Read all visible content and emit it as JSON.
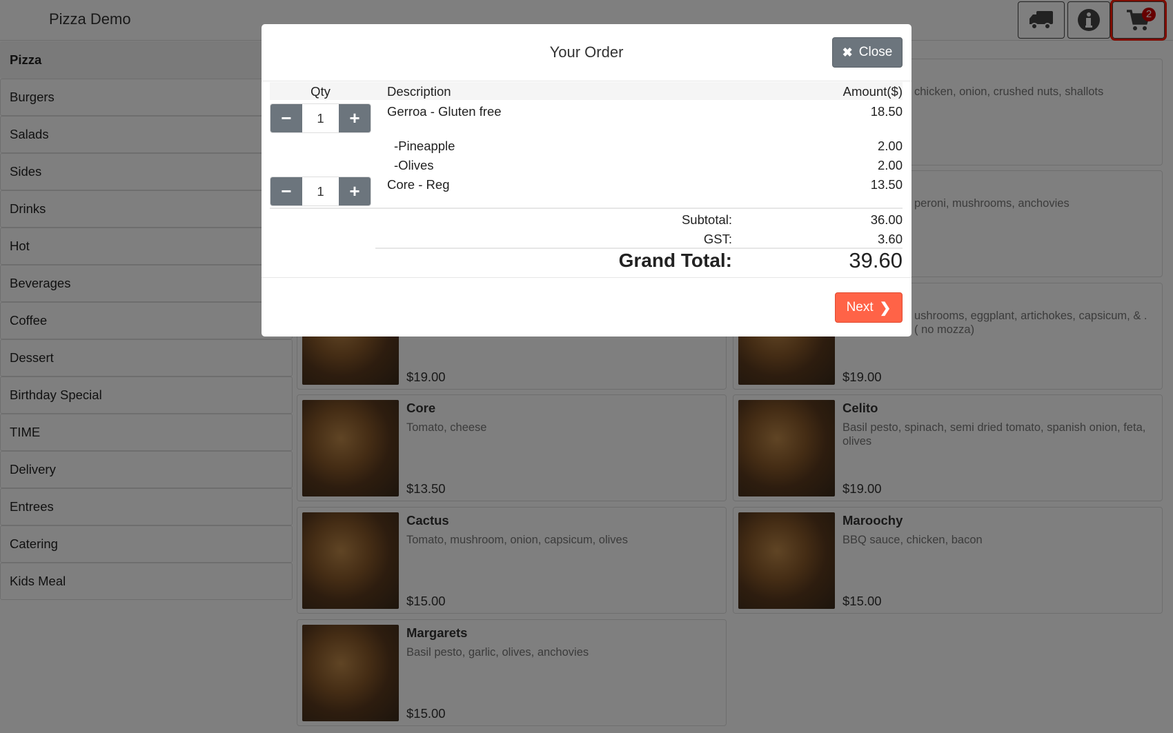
{
  "app": {
    "title": "Pizza Demo"
  },
  "header": {
    "buttons": [
      {
        "icon": "truck-icon"
      },
      {
        "icon": "info-icon"
      },
      {
        "icon": "cart-icon",
        "badge": "2"
      }
    ]
  },
  "sidebar": {
    "items": [
      "Pizza",
      "Burgers",
      "Salads",
      "Sides",
      "Drinks",
      "Hot",
      "Beverages",
      "Coffee",
      "Dessert",
      "Birthday Special",
      "TIME",
      "Delivery",
      "Entrees",
      "Catering",
      "Kids Meal"
    ]
  },
  "products": [
    {
      "name": "",
      "desc": "",
      "price": ""
    },
    {
      "name": "",
      "desc": "chicken, onion, crushed nuts, shallots",
      "price": ""
    },
    {
      "name": "",
      "desc": "",
      "price": ""
    },
    {
      "name": "",
      "desc": "peroni, mushrooms, anchovies",
      "price": ""
    },
    {
      "name": "",
      "desc": "",
      "price": "$19.00"
    },
    {
      "name": "",
      "desc": "ushrooms, eggplant, artichokes, capsicum, & . ( no mozza)",
      "price": "$19.00"
    },
    {
      "name": "Core",
      "desc": "Tomato, cheese",
      "price": "$13.50"
    },
    {
      "name": "Celito",
      "desc": "Basil pesto, spinach, semi dried tomato, spanish onion, feta, olives",
      "price": "$19.00"
    },
    {
      "name": "Cactus",
      "desc": "Tomato, mushroom, onion, capsicum, olives",
      "price": "$15.00"
    },
    {
      "name": "Maroochy",
      "desc": "BBQ sauce, chicken, bacon",
      "price": "$15.00"
    },
    {
      "name": "Margarets",
      "desc": "Basil pesto, garlic, olives, anchovies",
      "price": "$15.00"
    }
  ],
  "modal": {
    "title": "Your Order",
    "close_label": "Close",
    "next_label": "Next",
    "columns": {
      "qty": "Qty",
      "description": "Description",
      "amount": "Amount($)"
    },
    "items": [
      {
        "qty": "1",
        "description": "Gerroa - Gluten free",
        "amount": "18.50",
        "extras": [
          {
            "description": "-Pineapple",
            "amount": "2.00"
          },
          {
            "description": "-Olives",
            "amount": "2.00"
          }
        ]
      },
      {
        "qty": "1",
        "description": "Core - Reg",
        "amount": "13.50"
      }
    ],
    "subtotal_label": "Subtotal:",
    "subtotal": "36.00",
    "gst_label": "GST:",
    "gst": "3.60",
    "grand_total_label": "Grand Total:",
    "grand_total": "39.60"
  },
  "colors": {
    "accent": "#ff6347",
    "secondary": "#6c757d",
    "badge": "#cc0000",
    "highlight": "#ff1a00"
  }
}
